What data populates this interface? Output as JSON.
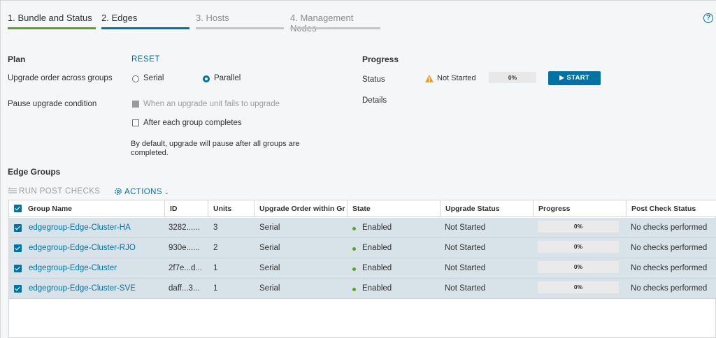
{
  "stepper": [
    {
      "label": "1. Bundle and Status"
    },
    {
      "label": "2. Edges"
    },
    {
      "label": "3. Hosts"
    },
    {
      "label": "4. Management Nodes"
    }
  ],
  "help_icon_text": "?",
  "plan": {
    "title": "Plan",
    "reset_label": "RESET",
    "upgrade_order_label": "Upgrade order across groups",
    "serial_label": "Serial",
    "parallel_label": "Parallel",
    "selected_order": "Parallel",
    "pause_condition_label": "Pause upgrade condition",
    "pause_on_failure_label": "When an upgrade unit fails to upgrade",
    "pause_after_group_label": "After each group completes",
    "default_note": "By default, upgrade will pause after all groups are completed."
  },
  "progress": {
    "title": "Progress",
    "status_label": "Status",
    "status_value": "Not Started",
    "percent": "0%",
    "start_label": "▶ START",
    "details_label": "Details"
  },
  "edge_groups": {
    "title": "Edge Groups",
    "run_post_checks_label": "RUN POST CHECKS",
    "actions_label": "ACTIONS",
    "columns": [
      "Group Name",
      "ID",
      "Units",
      "Upgrade Order within Gr",
      "State",
      "Upgrade Status",
      "Progress",
      "Post Check Status"
    ],
    "rows": [
      {
        "name": "edgegroup-Edge-Cluster-HA",
        "id": "3282......",
        "units": "3",
        "order": "Serial",
        "state": "Enabled",
        "upgrade_status": "Not Started",
        "progress": "0%",
        "post_check": "No checks performed"
      },
      {
        "name": "edgegroup-Edge-Cluster-RJO",
        "id": "930e......",
        "units": "2",
        "order": "Serial",
        "state": "Enabled",
        "upgrade_status": "Not Started",
        "progress": "0%",
        "post_check": "No checks performed"
      },
      {
        "name": "edgegroup-Edge-Cluster",
        "id": "2f7e...d...",
        "units": "1",
        "order": "Serial",
        "state": "Enabled",
        "upgrade_status": "Not Started",
        "progress": "0%",
        "post_check": "No checks performed"
      },
      {
        "name": "edgegroup-Edge-Cluster-SVE",
        "id": "daff...3...",
        "units": "1",
        "order": "Serial",
        "state": "Enabled",
        "upgrade_status": "Not Started",
        "progress": "0%",
        "post_check": "No checks performed"
      }
    ]
  },
  "colors": {
    "accent": "#0072a3",
    "success": "#5aa220",
    "warning": "#e7a024",
    "row_selected": "#d8e3e9"
  }
}
